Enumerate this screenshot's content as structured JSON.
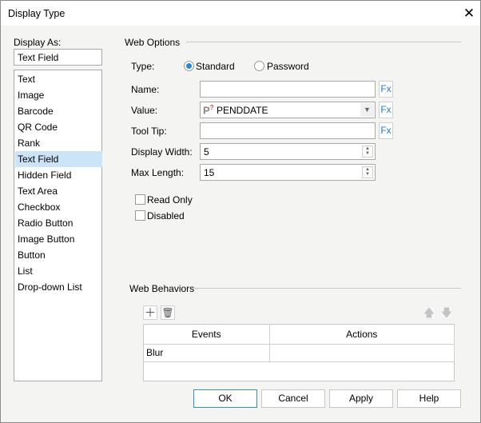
{
  "window": {
    "title": "Display Type"
  },
  "display_as": {
    "label": "Display As:",
    "value": "Text Field",
    "items": [
      "Text",
      "Image",
      "Barcode",
      "QR Code",
      "Rank",
      "Text Field",
      "Hidden Field",
      "Text Area",
      "Checkbox",
      "Radio Button",
      "Image Button",
      "Button",
      "List",
      "Drop-down List"
    ],
    "selected": "Text Field"
  },
  "web_options": {
    "title": "Web Options",
    "type_label": "Type:",
    "type_options": [
      "Standard",
      "Password"
    ],
    "type_selected": "Standard",
    "name_label": "Name:",
    "name_value": "",
    "value_label": "Value:",
    "value_value": "PENDDATE",
    "tooltip_label": "Tool Tip:",
    "tooltip_value": "",
    "display_width_label": "Display Width:",
    "display_width_value": "5",
    "max_length_label": "Max Length:",
    "max_length_value": "15",
    "fx_label": "Fx",
    "read_only_label": "Read Only",
    "read_only": false,
    "disabled_label": "Disabled",
    "disabled": false
  },
  "web_behaviors": {
    "title": "Web Behaviors",
    "columns": [
      "Events",
      "Actions"
    ],
    "rows": [
      [
        "Blur",
        ""
      ]
    ]
  },
  "buttons": {
    "ok": "OK",
    "cancel": "Cancel",
    "apply": "Apply",
    "help": "Help"
  },
  "colors": {
    "selection": "#cce4f7",
    "accent": "#1c8ae0",
    "fx": "#1e7ad6"
  }
}
